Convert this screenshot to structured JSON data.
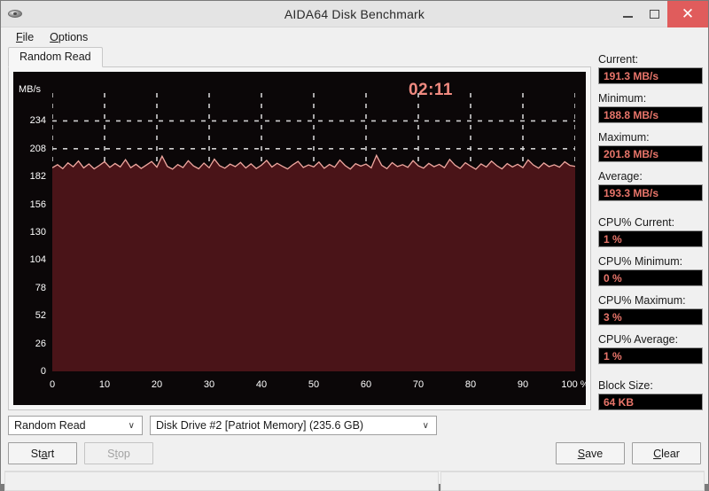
{
  "window": {
    "title": "AIDA64 Disk Benchmark",
    "app_icon": "disk-icon",
    "minimize_label": "",
    "maximize_label": "",
    "close_label": "✕"
  },
  "menu": {
    "items": [
      {
        "label": "File",
        "mnemonic": "F"
      },
      {
        "label": "Options",
        "mnemonic": "O"
      }
    ]
  },
  "tabs": [
    {
      "label": "Random Read",
      "active": true
    }
  ],
  "chart_data": {
    "type": "line",
    "title": "",
    "xlabel": "",
    "ylabel": "MB/s",
    "unit_label": "MB/s",
    "timer": "02:11",
    "xlim": [
      0,
      100
    ],
    "ylim": [
      0,
      260
    ],
    "yticks": [
      0,
      26,
      52,
      78,
      104,
      130,
      156,
      182,
      208,
      234
    ],
    "xticks": [
      "0",
      "10",
      "20",
      "30",
      "40",
      "50",
      "60",
      "70",
      "80",
      "90",
      "100 %"
    ],
    "xtick_values": [
      0,
      10,
      20,
      30,
      40,
      50,
      60,
      70,
      80,
      90,
      100
    ],
    "grid": true,
    "grid_color": "#cfcfcf",
    "line_color": "#f0a8a0",
    "fill_color": "#4a1418",
    "background": "#0b0708",
    "series": [
      {
        "name": "Random Read",
        "x": [
          0,
          1,
          2,
          3,
          4,
          5,
          6,
          7,
          8,
          9,
          10,
          11,
          12,
          13,
          14,
          15,
          16,
          17,
          18,
          19,
          20,
          21,
          22,
          23,
          24,
          25,
          26,
          27,
          28,
          29,
          30,
          31,
          32,
          33,
          34,
          35,
          36,
          37,
          38,
          39,
          40,
          41,
          42,
          43,
          44,
          45,
          46,
          47,
          48,
          49,
          50,
          51,
          52,
          53,
          54,
          55,
          56,
          57,
          58,
          59,
          60,
          61,
          62,
          63,
          64,
          65,
          66,
          67,
          68,
          69,
          70,
          71,
          72,
          73,
          74,
          75,
          76,
          77,
          78,
          79,
          80,
          81,
          82,
          83,
          84,
          85,
          86,
          87,
          88,
          89,
          90,
          91,
          92,
          93,
          94,
          95,
          96,
          97,
          98,
          99,
          100
        ],
        "values": [
          190.2,
          193.1,
          189.4,
          194.8,
          191.2,
          196.5,
          190.1,
          193.8,
          189.2,
          192.4,
          195.9,
          190.6,
          194.2,
          191.0,
          197.8,
          190.3,
          193.5,
          189.6,
          192.8,
          196.1,
          190.8,
          201.0,
          191.5,
          188.9,
          193.2,
          190.4,
          196.8,
          191.9,
          189.3,
          194.6,
          190.2,
          198.3,
          192.1,
          189.8,
          193.6,
          191.3,
          195.2,
          190.0,
          193.9,
          189.5,
          192.6,
          197.1,
          190.9,
          194.4,
          191.6,
          189.1,
          193.0,
          196.2,
          190.5,
          192.9,
          191.1,
          195.6,
          189.7,
          193.3,
          190.7,
          197.4,
          192.3,
          189.0,
          194.0,
          191.8,
          193.7,
          190.1,
          201.8,
          192.5,
          189.4,
          195.0,
          191.4,
          193.1,
          190.6,
          196.9,
          192.0,
          189.8,
          194.3,
          191.2,
          193.4,
          190.3,
          198.0,
          192.7,
          189.6,
          194.9,
          191.7,
          188.8,
          193.8,
          190.9,
          196.4,
          192.2,
          189.2,
          194.1,
          191.0,
          193.5,
          190.4,
          197.6,
          192.8,
          189.9,
          194.7,
          191.3,
          193.0,
          190.8,
          195.8,
          192.4,
          191.5
        ]
      }
    ]
  },
  "sidebar": {
    "stats": [
      {
        "label": "Current:",
        "value": "191.3 MB/s",
        "gap": false
      },
      {
        "label": "Minimum:",
        "value": "188.8 MB/s",
        "gap": false
      },
      {
        "label": "Maximum:",
        "value": "201.8 MB/s",
        "gap": false
      },
      {
        "label": "Average:",
        "value": "193.3 MB/s",
        "gap": false
      },
      {
        "label": "CPU% Current:",
        "value": "1 %",
        "gap": true
      },
      {
        "label": "CPU% Minimum:",
        "value": "0 %",
        "gap": false
      },
      {
        "label": "CPU% Maximum:",
        "value": "3 %",
        "gap": false
      },
      {
        "label": "CPU% Average:",
        "value": "1 %",
        "gap": false
      },
      {
        "label": "Block Size:",
        "value": "64 KB",
        "gap": true
      }
    ]
  },
  "controls": {
    "mode_select": {
      "value": "Random Read",
      "arrow": "∨"
    },
    "drive_select": {
      "value": "Disk Drive #2  [Patriot Memory]  (235.6 GB)",
      "arrow": "∨"
    },
    "start_button": {
      "label": "Start",
      "mnemonic": "a",
      "disabled": false
    },
    "stop_button": {
      "label": "Stop",
      "mnemonic": "t",
      "disabled": true
    },
    "save_button": {
      "label": "Save",
      "mnemonic": "S",
      "disabled": false
    },
    "clear_button": {
      "label": "Clear",
      "mnemonic": "C",
      "disabled": false
    }
  },
  "statusbar": {
    "left": "",
    "right": ""
  }
}
